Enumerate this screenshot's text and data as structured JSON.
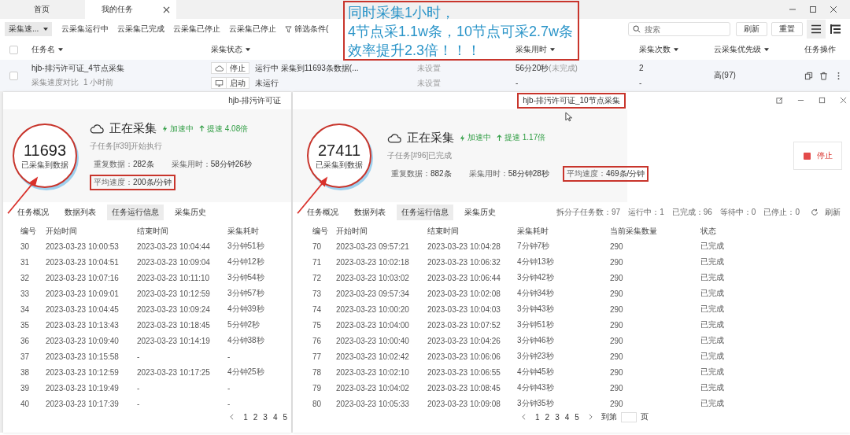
{
  "tabs": [
    {
      "label": "首页",
      "selected": false,
      "closable": false
    },
    {
      "label": "我的任务",
      "selected": true,
      "closable": true
    }
  ],
  "toolbar": {
    "group_select": "采集速...",
    "filters": [
      "云采集运行中",
      "云采集已完成",
      "云采集已停止",
      "云采集已停止"
    ],
    "filter_button": "筛选条件(",
    "search": {
      "placeholder": "搜索"
    },
    "buttons": [
      "刷新",
      "重置"
    ]
  },
  "task_table": {
    "select_all": {
      "checked": false
    },
    "columns": [
      {
        "label": "任务名",
        "sortable": true
      },
      {
        "label": "采集状态",
        "sortable": true
      },
      {
        "label": "采集用时",
        "sortable": true
      },
      {
        "label": "采集次数",
        "sortable": true
      },
      {
        "label": "云采集优先级",
        "sortable": true
      },
      {
        "label": "任务操作",
        "sortable": false
      }
    ],
    "rows": [
      {
        "checked": false,
        "name": "hjb-排污许可证_4节点采集",
        "group": "采集速度对比",
        "time": "1 小时前",
        "runs": [
          {
            "kind": "cloud",
            "action": "停止",
            "status": "运行中 采集到11693条数据(...",
            "setting": "未设置",
            "duration": "56分20秒",
            "duration_note": "(未完成)",
            "count": "2"
          },
          {
            "kind": "local",
            "action": "启动",
            "status": "未运行",
            "setting": "未设置",
            "duration": "-",
            "count": "-"
          }
        ],
        "priority": "高(97)"
      }
    ]
  },
  "annotation": {
    "lines": [
      "同时采集1小时，",
      "4节点采1.1w条，10节点可采2.7w条",
      "效率提升2.3倍！！！"
    ]
  },
  "panels": [
    {
      "title": "hjb-排污许可证",
      "title_highlighted": false,
      "count": "11693",
      "count_label": "已采集到数据",
      "status": "正在采集",
      "accel": "加速中",
      "boost": "提速 4.08倍",
      "subtask": "子任务[#39]开始执行",
      "stats": [
        {
          "label": "重复数据：",
          "value": "282条",
          "highlighted": false
        },
        {
          "label": "采集用时：",
          "value": "58分钟26秒",
          "highlighted": false
        },
        {
          "label": "平均速度：",
          "value": "200条/分钟",
          "highlighted": true
        }
      ],
      "tabs": [
        {
          "label": "任务概况",
          "selected": false
        },
        {
          "label": "数据列表",
          "selected": false
        },
        {
          "label": "任务运行信息",
          "selected": true
        },
        {
          "label": "采集历史",
          "selected": false
        }
      ],
      "columns": [
        "编号",
        "开始时间",
        "结束时间",
        "采集耗时"
      ],
      "rows": [
        [
          "30",
          "2023-03-23 10:00:53",
          "2023-03-23 10:04:44",
          "3分钟51秒"
        ],
        [
          "31",
          "2023-03-23 10:04:51",
          "2023-03-23 10:09:04",
          "4分钟12秒"
        ],
        [
          "32",
          "2023-03-23 10:07:16",
          "2023-03-23 10:11:10",
          "3分钟54秒"
        ],
        [
          "33",
          "2023-03-23 10:09:01",
          "2023-03-23 10:12:59",
          "3分钟57秒"
        ],
        [
          "34",
          "2023-03-23 10:04:45",
          "2023-03-23 10:09:24",
          "4分钟39秒"
        ],
        [
          "35",
          "2023-03-23 10:13:43",
          "2023-03-23 10:18:45",
          "5分钟2秒"
        ],
        [
          "36",
          "2023-03-23 10:09:40",
          "2023-03-23 10:14:19",
          "4分钟38秒"
        ],
        [
          "37",
          "2023-03-23 10:15:58",
          "-",
          "-"
        ],
        [
          "38",
          "2023-03-23 10:12:59",
          "2023-03-23 10:17:25",
          "4分钟25秒"
        ],
        [
          "39",
          "2023-03-23 10:19:49",
          "-",
          "-"
        ],
        [
          "40",
          "2023-03-23 10:17:39",
          "-",
          "-"
        ]
      ],
      "pages": [
        "1",
        "2",
        "3",
        "4",
        "5"
      ]
    },
    {
      "title": "hjb-排污许可证_10节点采集",
      "title_highlighted": true,
      "count": "27411",
      "count_label": "已采集到数据",
      "status": "正在采集",
      "accel": "加速中",
      "boost": "提速 1.17倍",
      "subtask": "子任务[#96]已完成",
      "stats": [
        {
          "label": "重复数据：",
          "value": "882条",
          "highlighted": false
        },
        {
          "label": "采集用时：",
          "value": "58分钟28秒",
          "highlighted": false
        },
        {
          "label": "平均速度：",
          "value": "469条/分钟",
          "highlighted": true
        }
      ],
      "stop_button": "停止",
      "summary": "拆分子任务数：97　运行中：1　已完成：96　等待中：0　已停止：0",
      "refresh": "刷新",
      "tabs": [
        {
          "label": "任务概况",
          "selected": false
        },
        {
          "label": "数据列表",
          "selected": false
        },
        {
          "label": "任务运行信息",
          "selected": true
        },
        {
          "label": "采集历史",
          "selected": false
        }
      ],
      "columns": [
        "编号",
        "开始时间",
        "结束时间",
        "采集耗时",
        "当前采集数量",
        "状态"
      ],
      "rows": [
        [
          "70",
          "2023-03-23 09:57:21",
          "2023-03-23 10:04:28",
          "7分钟7秒",
          "290",
          "已完成"
        ],
        [
          "71",
          "2023-03-23 10:02:18",
          "2023-03-23 10:06:32",
          "4分钟13秒",
          "290",
          "已完成"
        ],
        [
          "72",
          "2023-03-23 10:03:02",
          "2023-03-23 10:06:44",
          "3分钟42秒",
          "290",
          "已完成"
        ],
        [
          "73",
          "2023-03-23 09:57:34",
          "2023-03-23 10:02:08",
          "4分钟34秒",
          "290",
          "已完成"
        ],
        [
          "74",
          "2023-03-23 10:00:20",
          "2023-03-23 10:04:03",
          "3分钟43秒",
          "290",
          "已完成"
        ],
        [
          "75",
          "2023-03-23 10:04:00",
          "2023-03-23 10:07:52",
          "3分钟51秒",
          "290",
          "已完成"
        ],
        [
          "76",
          "2023-03-23 10:00:40",
          "2023-03-23 10:04:26",
          "3分钟46秒",
          "290",
          "已完成"
        ],
        [
          "77",
          "2023-03-23 10:02:42",
          "2023-03-23 10:06:06",
          "3分钟23秒",
          "290",
          "已完成"
        ],
        [
          "78",
          "2023-03-23 10:02:10",
          "2023-03-23 10:06:55",
          "4分钟45秒",
          "290",
          "已完成"
        ],
        [
          "79",
          "2023-03-23 10:04:02",
          "2023-03-23 10:08:45",
          "4分钟43秒",
          "290",
          "已完成"
        ],
        [
          "80",
          "2023-03-23 10:05:33",
          "2023-03-23 10:09:08",
          "3分钟35秒",
          "290",
          "已完成"
        ]
      ],
      "pages": [
        "1",
        "2",
        "3",
        "4",
        "5"
      ],
      "goto": {
        "before": "到第",
        "after": "页"
      }
    }
  ]
}
